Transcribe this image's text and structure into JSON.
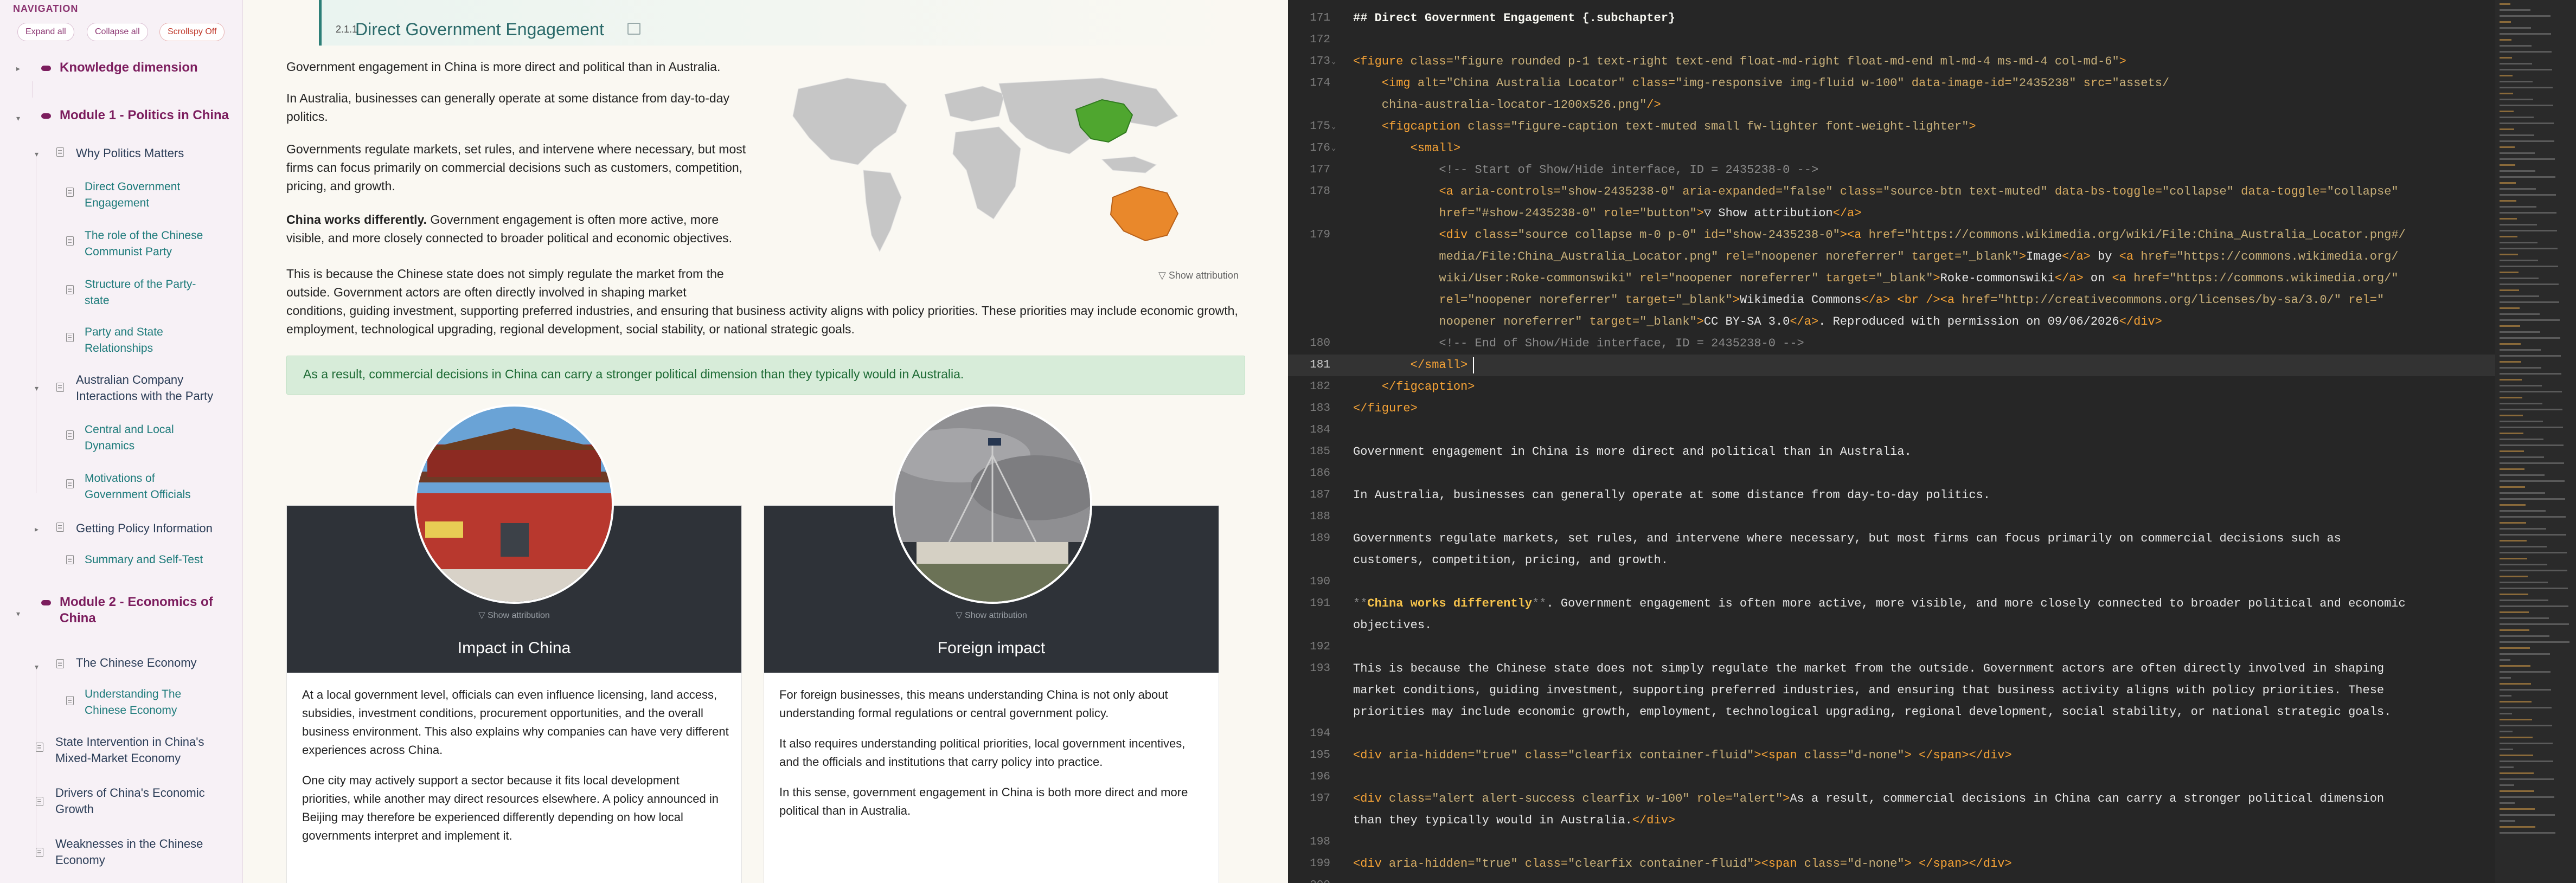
{
  "sidebar": {
    "heading": "NAVIGATION",
    "buttons": {
      "expand": "Expand all",
      "collapse": "Collapse all",
      "scrollspy": "Scrollspy Off"
    },
    "items": [
      {
        "label": "Knowledge dimension"
      },
      {
        "label": "Module 1 - Politics in China"
      },
      {
        "label": "Why Politics Matters"
      },
      {
        "label": "Direct Government Engagement"
      },
      {
        "label": "The role of the Chinese Communist Party"
      },
      {
        "label": "Structure of the Party-state"
      },
      {
        "label": "Party and State Relationships"
      },
      {
        "label": "Australian Company Interactions with the Party"
      },
      {
        "label": "Central and Local Dynamics"
      },
      {
        "label": "Motivations of Government Officials"
      },
      {
        "label": "Getting Policy Information"
      },
      {
        "label": "Summary and Self-Test"
      },
      {
        "label": "Module 2 - Economics of China"
      },
      {
        "label": "The Chinese Economy"
      },
      {
        "label": "Understanding The Chinese Economy"
      },
      {
        "label": "State Intervention in China's Mixed-Market Economy"
      },
      {
        "label": "Drivers of China's Economic Growth"
      },
      {
        "label": "Weaknesses in the Chinese Economy"
      }
    ]
  },
  "main": {
    "chapter_number": "2.1.1",
    "chapter_title": "Direct Government Engagement",
    "paragraphs": [
      "Government engagement in China is more direct and political than in Australia.",
      "In Australia, businesses can generally operate at some distance from day-to-day politics.",
      "Governments regulate markets, set rules, and intervene where necessary, but most firms can focus primarily on commercial decisions such as customers, competition, pricing, and growth."
    ],
    "bold_lead": "China works differently.",
    "bold_rest": " Government engagement is often more active, more visible, and more closely connected to broader political and economic objectives.",
    "para5_lines": [
      "This is because the Chinese state does not simply regulate the market from the",
      "outside. Government actors are often directly involved in shaping market",
      "conditions, guiding investment, supporting preferred industries, and ensuring that business activity aligns with policy priorities. These priorities may include economic growth,",
      "employment, technological upgrading, regional development, social stability, or national strategic goals."
    ],
    "map_attribution": "▽ Show attribution",
    "alert": "As a result, commercial decisions in China can carry a stronger political dimension than they typically would in Australia.",
    "cards": [
      {
        "title": "Impact in China",
        "attribution": "▽ Show attribution",
        "paragraphs": [
          "At a local government level, officials can even influence licensing, land access, subsidies, investment conditions, procurement opportunities, and the overall business environment. This also explains why companies can have very different experiences across China.",
          "One city may actively support a sector because it fits local development priorities, while another may direct resources elsewhere. A policy announced in Beijing may therefore be experienced differently depending on how local governments interpret and implement it."
        ]
      },
      {
        "title": "Foreign impact",
        "attribution": "▽ Show attribution",
        "paragraphs": [
          "For foreign businesses, this means understanding China is not only about understanding formal regulations or central government policy.",
          "It also requires understanding political priorities, local government incentives, and the officials and institutions that carry policy into practice.",
          "In this sense, government engagement in China is both more direct and more political than in Australia."
        ]
      }
    ]
  },
  "editor": {
    "lines": [
      {
        "n": "171",
        "fold": "",
        "parts": [
          [
            "t-head",
            "## Direct Government Engagement {.subchapter}"
          ]
        ]
      },
      {
        "n": "172",
        "fold": "",
        "parts": []
      },
      {
        "n": "173",
        "fold": "⌄",
        "parts": [
          [
            "t-tag",
            "<figure "
          ],
          [
            "t-attr",
            "class="
          ],
          [
            "t-str",
            "\"figure rounded p-1 text-right text-end float-md-right float-md-end ml-md-4 ms-md-4 col-md-6\""
          ],
          [
            "t-tag",
            ">"
          ]
        ]
      },
      {
        "n": "174",
        "fold": "",
        "parts": [
          [
            "t-txt",
            "    "
          ],
          [
            "t-tag",
            "<img "
          ],
          [
            "t-attr",
            "alt="
          ],
          [
            "t-str",
            "\"China Australia Locator\" "
          ],
          [
            "t-attr",
            "class="
          ],
          [
            "t-str",
            "\"img-responsive img-fluid w-100\" "
          ],
          [
            "t-attr",
            "data-image-id="
          ],
          [
            "t-str",
            "\"2435238\" "
          ],
          [
            "t-attr",
            "src="
          ],
          [
            "t-str",
            "\"assets/"
          ]
        ]
      },
      {
        "n": "",
        "fold": "",
        "parts": [
          [
            "t-str",
            "    china-australia-locator-1200x526.png\""
          ],
          [
            "t-tag",
            "/>"
          ]
        ]
      },
      {
        "n": "175",
        "fold": "⌄",
        "parts": [
          [
            "t-txt",
            "    "
          ],
          [
            "t-tag",
            "<figcaption "
          ],
          [
            "t-attr",
            "class="
          ],
          [
            "t-str",
            "\"figure-caption text-muted small fw-lighter font-weight-lighter\""
          ],
          [
            "t-tag",
            ">"
          ]
        ]
      },
      {
        "n": "176",
        "fold": "⌄",
        "parts": [
          [
            "t-txt",
            "        "
          ],
          [
            "t-tag",
            "<small>"
          ]
        ]
      },
      {
        "n": "177",
        "fold": "",
        "parts": [
          [
            "t-cm",
            "            <!-- Start of Show/Hide interface, ID = 2435238-0 -->"
          ]
        ]
      },
      {
        "n": "178",
        "fold": "",
        "parts": [
          [
            "t-txt",
            "            "
          ],
          [
            "t-tag",
            "<a "
          ],
          [
            "t-attr",
            "aria-controls="
          ],
          [
            "t-str",
            "\"show-2435238-0\" "
          ],
          [
            "t-attr",
            "aria-expanded="
          ],
          [
            "t-str",
            "\"false\" "
          ],
          [
            "t-attr",
            "class="
          ],
          [
            "t-str",
            "\"source-btn text-muted\" "
          ],
          [
            "t-attr",
            "data-bs-toggle="
          ],
          [
            "t-str",
            "\"collapse\" "
          ],
          [
            "t-attr",
            "data-toggle="
          ],
          [
            "t-str",
            "\"collapse\""
          ]
        ]
      },
      {
        "n": "",
        "fold": "",
        "parts": [
          [
            "t-txt",
            "            "
          ],
          [
            "t-attr",
            "href="
          ],
          [
            "t-str",
            "\"#show-2435238-0\" "
          ],
          [
            "t-attr",
            "role="
          ],
          [
            "t-str",
            "\"button\""
          ],
          [
            "t-tag",
            ">"
          ],
          [
            "t-txt",
            "▽ Show attribution"
          ],
          [
            "t-tag",
            "</a>"
          ]
        ]
      },
      {
        "n": "179",
        "fold": "",
        "parts": [
          [
            "t-txt",
            "            "
          ],
          [
            "t-tag",
            "<div "
          ],
          [
            "t-attr",
            "class="
          ],
          [
            "t-str",
            "\"source collapse m-0 p-0\" "
          ],
          [
            "t-attr",
            "id="
          ],
          [
            "t-str",
            "\"show-2435238-0\""
          ],
          [
            "t-tag",
            "><a "
          ],
          [
            "t-attr",
            "href="
          ],
          [
            "t-str",
            "\"https://commons.wikimedia.org/wiki/File:China_Australia_Locator.png#/"
          ]
        ]
      },
      {
        "n": "",
        "fold": "",
        "parts": [
          [
            "t-str",
            "            media/File:China_Australia_Locator.png\" "
          ],
          [
            "t-attr",
            "rel="
          ],
          [
            "t-str",
            "\"noopener noreferrer\" "
          ],
          [
            "t-attr",
            "target="
          ],
          [
            "t-str",
            "\"_blank\""
          ],
          [
            "t-tag",
            ">"
          ],
          [
            "t-txt",
            "Image"
          ],
          [
            "t-tag",
            "</a>"
          ],
          [
            "t-txt",
            " by "
          ],
          [
            "t-tag",
            "<a "
          ],
          [
            "t-attr",
            "href="
          ],
          [
            "t-str",
            "\"https://commons.wikimedia.org/"
          ]
        ]
      },
      {
        "n": "",
        "fold": "",
        "parts": [
          [
            "t-str",
            "            wiki/User:Roke-commonswiki\" "
          ],
          [
            "t-attr",
            "rel="
          ],
          [
            "t-str",
            "\"noopener noreferrer\" "
          ],
          [
            "t-attr",
            "target="
          ],
          [
            "t-str",
            "\"_blank\""
          ],
          [
            "t-tag",
            ">"
          ],
          [
            "t-txt",
            "Roke-commonswiki"
          ],
          [
            "t-tag",
            "</a>"
          ],
          [
            "t-txt",
            " on "
          ],
          [
            "t-tag",
            "<a "
          ],
          [
            "t-attr",
            "href="
          ],
          [
            "t-str",
            "\"https://commons.wikimedia.org/\""
          ]
        ]
      },
      {
        "n": "",
        "fold": "",
        "parts": [
          [
            "t-txt",
            "            "
          ],
          [
            "t-attr",
            "rel="
          ],
          [
            "t-str",
            "\"noopener noreferrer\" "
          ],
          [
            "t-attr",
            "target="
          ],
          [
            "t-str",
            "\"_blank\""
          ],
          [
            "t-tag",
            ">"
          ],
          [
            "t-txt",
            "Wikimedia Commons"
          ],
          [
            "t-tag",
            "</a>"
          ],
          [
            "t-txt",
            " "
          ],
          [
            "t-tag",
            "<br />"
          ],
          [
            "t-tag",
            "<a "
          ],
          [
            "t-attr",
            "href="
          ],
          [
            "t-str",
            "\"http://creativecommons.org/licenses/by-sa/3.0/\" "
          ],
          [
            "t-attr",
            "rel="
          ],
          [
            "t-str",
            "\""
          ]
        ]
      },
      {
        "n": "",
        "fold": "",
        "parts": [
          [
            "t-str",
            "            noopener noreferrer\" "
          ],
          [
            "t-attr",
            "target="
          ],
          [
            "t-str",
            "\"_blank\""
          ],
          [
            "t-tag",
            ">"
          ],
          [
            "t-txt",
            "CC BY-SA 3.0"
          ],
          [
            "t-tag",
            "</a>"
          ],
          [
            "t-txt",
            ". Reproduced with permission on 09/06/2026"
          ],
          [
            "t-tag",
            "</div>"
          ]
        ]
      },
      {
        "n": "180",
        "fold": "",
        "parts": [
          [
            "t-cm",
            "            <!-- End of Show/Hide interface, ID = 2435238-0 -->"
          ]
        ]
      },
      {
        "n": "181",
        "fold": "",
        "current": true,
        "parts": [
          [
            "t-txt",
            "        "
          ],
          [
            "t-tag",
            "</small>"
          ]
        ]
      },
      {
        "n": "182",
        "fold": "",
        "parts": [
          [
            "t-txt",
            "    "
          ],
          [
            "t-tag",
            "</figcaption>"
          ]
        ]
      },
      {
        "n": "183",
        "fold": "",
        "parts": [
          [
            "t-tag",
            "</figure>"
          ]
        ]
      },
      {
        "n": "184",
        "fold": "",
        "parts": []
      },
      {
        "n": "185",
        "fold": "",
        "parts": [
          [
            "t-txt",
            "Government engagement in China is more "
          ],
          [
            "t-txt",
            "direct"
          ],
          [
            "t-txt",
            " and political than in Australia."
          ]
        ]
      },
      {
        "n": "186",
        "fold": "",
        "parts": []
      },
      {
        "n": "187",
        "fold": "",
        "parts": [
          [
            "t-txt",
            "In Australia, businesses can generally operate at some distance from day-to-day politics."
          ]
        ]
      },
      {
        "n": "188",
        "fold": "",
        "parts": []
      },
      {
        "n": "189",
        "fold": "",
        "parts": [
          [
            "t-txt",
            "Governments regulate markets, set rules, and intervene where necessary, but most firms can focus primarily on commercial decisions such as"
          ]
        ]
      },
      {
        "n": "",
        "fold": "",
        "parts": [
          [
            "t-txt",
            "customers, competition, pricing, and growth."
          ]
        ]
      },
      {
        "n": "190",
        "fold": "",
        "parts": []
      },
      {
        "n": "191",
        "fold": "",
        "parts": [
          [
            "t-cm",
            "**"
          ],
          [
            "t-bold",
            "China works differently"
          ],
          [
            "t-cm",
            "**"
          ],
          [
            "t-txt",
            ". Government engagement is often more active, more visible, and more closely connected to broader political and economic"
          ]
        ]
      },
      {
        "n": "",
        "fold": "",
        "parts": [
          [
            "t-txt",
            "objectives."
          ]
        ]
      },
      {
        "n": "192",
        "fold": "",
        "parts": []
      },
      {
        "n": "193",
        "fold": "",
        "parts": [
          [
            "t-txt",
            "This is because the Chinese state does not simply regulate the market from the outside. Government actors are often directly involved in shaping"
          ]
        ]
      },
      {
        "n": "",
        "fold": "",
        "parts": [
          [
            "t-txt",
            "market conditions, guiding investment, supporting preferred industries, and ensuring that business activity aligns with policy priorities. These"
          ]
        ]
      },
      {
        "n": "",
        "fold": "",
        "parts": [
          [
            "t-txt",
            "priorities may include economic growth, employment, technological upgrading, regional development, social stability, or national strategic goals."
          ]
        ]
      },
      {
        "n": "194",
        "fold": "",
        "parts": []
      },
      {
        "n": "195",
        "fold": "",
        "parts": [
          [
            "t-tag",
            "<div "
          ],
          [
            "t-attr",
            "aria-hidden="
          ],
          [
            "t-str",
            "\"true\" "
          ],
          [
            "t-attr",
            "class="
          ],
          [
            "t-str",
            "\"clearfix container-fluid\""
          ],
          [
            "t-tag",
            "><span "
          ],
          [
            "t-attr",
            "class="
          ],
          [
            "t-str",
            "\"d-none\""
          ],
          [
            "t-tag",
            "> </span></div>"
          ]
        ]
      },
      {
        "n": "196",
        "fold": "",
        "parts": []
      },
      {
        "n": "197",
        "fold": "",
        "parts": [
          [
            "t-tag",
            "<div "
          ],
          [
            "t-attr",
            "class="
          ],
          [
            "t-str",
            "\"alert alert-success clearfix w-100\" "
          ],
          [
            "t-attr",
            "role="
          ],
          [
            "t-str",
            "\"alert\""
          ],
          [
            "t-tag",
            ">"
          ],
          [
            "t-txt",
            "As a result, commercial decisions in China can carry a stronger political dimension"
          ]
        ]
      },
      {
        "n": "",
        "fold": "",
        "parts": [
          [
            "t-txt",
            "than they typically would in Australia."
          ],
          [
            "t-tag",
            "</div>"
          ]
        ]
      },
      {
        "n": "198",
        "fold": "",
        "parts": []
      },
      {
        "n": "199",
        "fold": "",
        "parts": [
          [
            "t-tag",
            "<div "
          ],
          [
            "t-attr",
            "aria-hidden="
          ],
          [
            "t-str",
            "\"true\" "
          ],
          [
            "t-attr",
            "class="
          ],
          [
            "t-str",
            "\"clearfix container-fluid\""
          ],
          [
            "t-tag",
            "><span "
          ],
          [
            "t-attr",
            "class="
          ],
          [
            "t-str",
            "\"d-none\""
          ],
          [
            "t-tag",
            "> </span></div>"
          ]
        ]
      },
      {
        "n": "200",
        "fold": "",
        "parts": []
      }
    ]
  }
}
